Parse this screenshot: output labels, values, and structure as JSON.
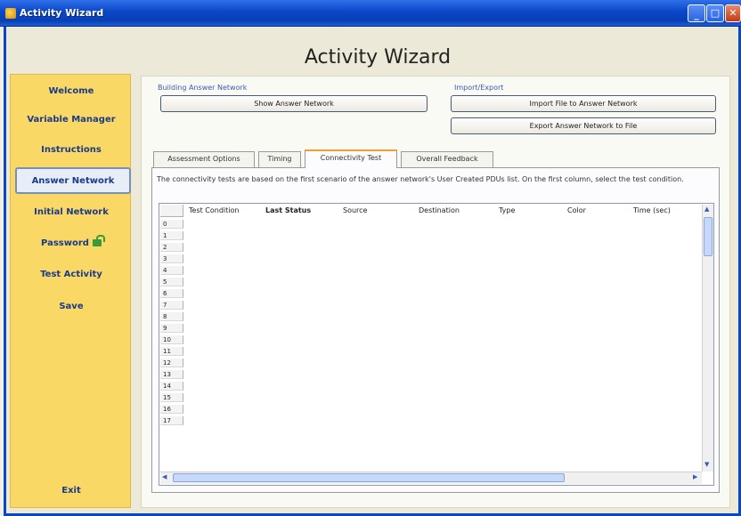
{
  "window": {
    "title": "Activity Wizard",
    "min_glyph": "_",
    "max_glyph": "□",
    "close_glyph": "✕"
  },
  "header": {
    "title": "Activity Wizard"
  },
  "sidebar": {
    "items": [
      {
        "label": "Welcome"
      },
      {
        "label": "Variable Manager"
      },
      {
        "label": "Instructions"
      },
      {
        "label": "Answer Network"
      },
      {
        "label": "Initial Network"
      },
      {
        "label": "Password"
      },
      {
        "label": "Test Activity"
      },
      {
        "label": "Save"
      },
      {
        "label": "Exit"
      }
    ]
  },
  "building": {
    "label": "Building Answer Network",
    "show_button": "Show Answer Network"
  },
  "import_export": {
    "label": "Import/Export",
    "import_button": "Import File to Answer Network",
    "export_button": "Export Answer Network to File"
  },
  "tabs": [
    {
      "label": "Assessment Options"
    },
    {
      "label": "Timing"
    },
    {
      "label": "Connectivity Test"
    },
    {
      "label": "Overall Feedback"
    }
  ],
  "connectivity": {
    "description": "The connectivity tests are based on the first scenario of the answer network's User Created PDUs list. On the first column, select the test condition.",
    "columns": [
      "Test Condition",
      "Last Status",
      "Source",
      "Destination",
      "Type",
      "Color",
      "Time (sec)"
    ],
    "rows": [
      "0",
      "1",
      "2",
      "3",
      "4",
      "5",
      "6",
      "7",
      "8",
      "9",
      "10",
      "11",
      "12",
      "13",
      "14",
      "15",
      "16",
      "17"
    ]
  },
  "icons": {
    "scroll_up": "▲",
    "scroll_down": "▼",
    "scroll_left": "◀",
    "scroll_right": "▶"
  }
}
